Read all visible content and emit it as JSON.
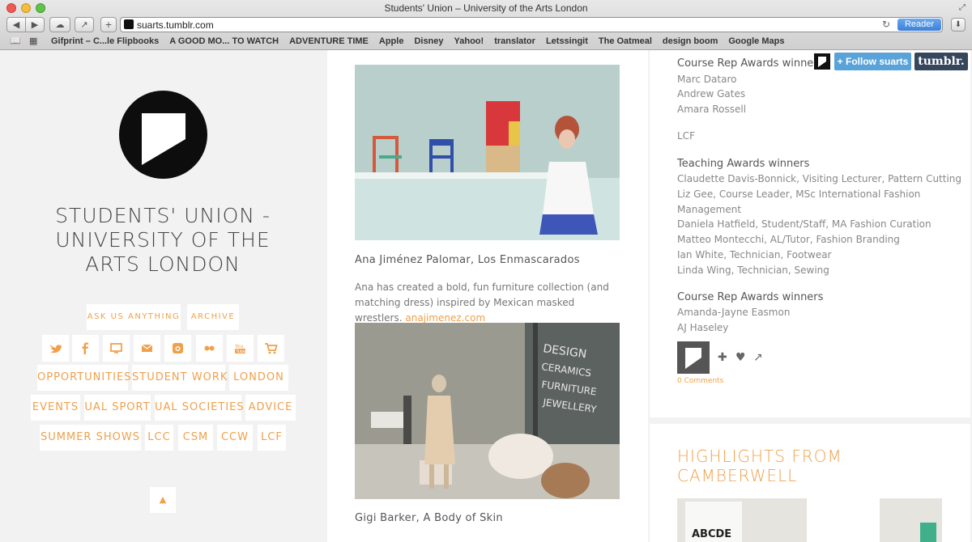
{
  "window": {
    "title": "Students' Union – University of the Arts London"
  },
  "toolbar": {
    "url": "suarts.tumblr.com",
    "reader_label": "Reader"
  },
  "bookmarks": [
    "Gifprint – C...le Flipbooks",
    "A GOOD MO... TO WATCH",
    "ADVENTURE TIME",
    "Apple",
    "Disney",
    "Yahoo!",
    "translator",
    "Letssingit",
    "The Oatmeal",
    "design boom",
    "Google Maps"
  ],
  "sidebar": {
    "title": "STUDENTS' UNION - UNIVERSITY OF THE ARTS LONDON",
    "ask_label": "ASK US ANYTHING",
    "archive_label": "ARCHIVE",
    "social_icons": [
      "twitter-icon",
      "facebook-icon",
      "monitor-icon",
      "mail-icon",
      "instagram-icon",
      "flickr-icon",
      "youtube-icon",
      "cart-icon"
    ],
    "nav": {
      "opportunities": "OPPORTUNITIES",
      "student_work": "STUDENT WORK",
      "london": "LONDON",
      "events": "EVENTS",
      "ual_sport": "UAL SPORT",
      "ual_societies": "UAL SOCIETIES",
      "advice": "ADVICE",
      "summer_shows": "SUMMER SHOWS",
      "lcc": "LCC",
      "csm": "CSM",
      "ccw": "CCW",
      "lcf": "LCF"
    },
    "up_icon": "▲"
  },
  "posts": {
    "post1_caption": "Ana Jiménez Palomar, Los Enmascarados",
    "post1_body": "Ana has created a bold, fun furniture collection (and matching dress) inspired by Mexican masked wrestlers.",
    "post1_link": "anajimenez.com",
    "post2_caption": "Gigi Barker, A Body of Skin",
    "window_text": [
      "DESIGN",
      "CERAMICS",
      "FURNITURE",
      "JEWELLERY"
    ]
  },
  "right": {
    "heading1": "Course Rep Awards winners",
    "list1": [
      "Marc Dataro",
      "Andrew Gates",
      "Amara Rossell"
    ],
    "lcf": "LCF",
    "heading2": "Teaching Awards winners",
    "list2": [
      "Claudette Davis-Bonnick, Visiting Lecturer, Pattern Cutting",
      "Liz Gee, Course Leader, MSc International Fashion",
      "Management",
      "Daniela Hatfield, Student/Staff, MA Fashion Curation",
      "Matteo Montecchi, AL/Tutor, Fashion Branding",
      "Ian White, Technician, Footwear",
      "Linda Wing, Technician, Sewing"
    ],
    "heading3": "Course Rep Awards winners",
    "list3": [
      "Amanda-Jayne Easmon",
      "AJ Haseley"
    ],
    "comments": "0 Comments",
    "highlights_title": "HIGHLIGHTS FROM CAMBERWELL",
    "hl_photo_text": "ABCDE"
  },
  "tumblr": {
    "follow_label": "+ Follow suarts",
    "brand": "tumblr."
  },
  "colors": {
    "accent": "#f0a04b",
    "tumblr_blue": "#5aa3d8",
    "tumblr_navy": "#36465d"
  }
}
